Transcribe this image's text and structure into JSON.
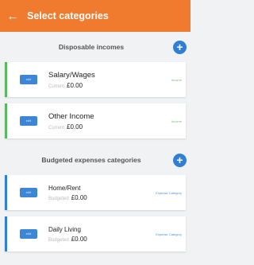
{
  "header": {
    "back_label": "←",
    "title": "Select categories"
  },
  "income_section": {
    "title": "Disposable incomes",
    "add_label": "+"
  },
  "income_items": [
    {
      "chip": "edit",
      "name": "Salary/Wages",
      "amount_label": "Current",
      "amount": "£0.00",
      "tag": "Income"
    },
    {
      "chip": "edit",
      "name": "Other Income",
      "amount_label": "Current",
      "amount": "£0.00",
      "tag": "Income"
    }
  ],
  "expense_section": {
    "title": "Budgeted expenses categories",
    "add_label": "+"
  },
  "expense_items": [
    {
      "chip": "edit",
      "name": "Home/Rent",
      "amount_label": "Budgeted",
      "amount": "£0.00",
      "tag": "Expense Category"
    },
    {
      "chip": "edit",
      "name": "Daily Living",
      "amount_label": "Budgeted",
      "amount": "£0.00",
      "tag": "Expense Category"
    }
  ],
  "colors": {
    "header": "#f07b2e",
    "income_accent": "#5cb85c",
    "expense_accent": "#2f7fd6",
    "add_button": "#2f7fd6"
  }
}
